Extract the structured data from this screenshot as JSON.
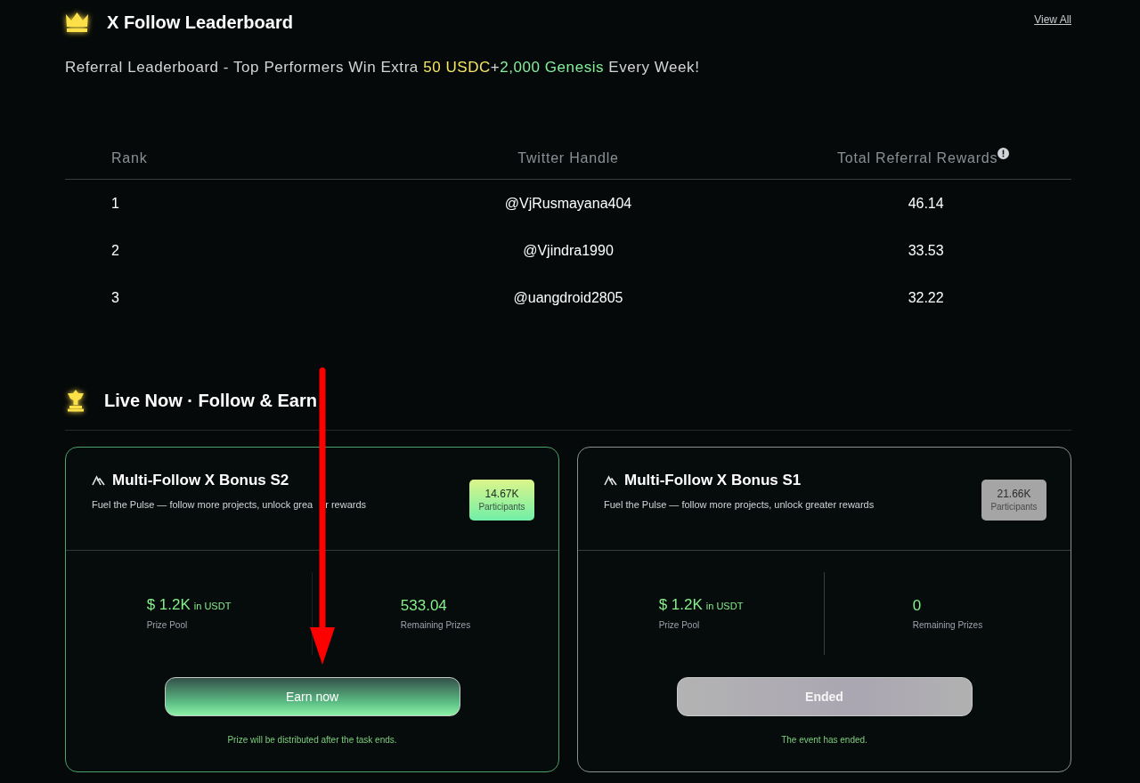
{
  "leaderboard": {
    "title": "X Follow Leaderboard",
    "view_all": "View All",
    "subtitle": [
      {
        "kind": "plain",
        "text": "Referral Leaderboard - Top Performers Win Extra "
      },
      {
        "kind": "usdc",
        "text": "50 USDC"
      },
      {
        "kind": "plain",
        "text": "+"
      },
      {
        "kind": "genesis",
        "text": "2,000 Genesis"
      },
      {
        "kind": "plain",
        "text": " Every Week!"
      }
    ],
    "table": {
      "columns": [
        "Rank",
        "Twitter Handle",
        "Total Referral Rewards"
      ],
      "rows": [
        {
          "rank": "1",
          "handle": "@VjRusmayana404",
          "rewards": "46.14"
        },
        {
          "rank": "2",
          "handle": "@Vjindra1990",
          "rewards": "33.53"
        },
        {
          "rank": "3",
          "handle": "@uangdroid2805",
          "rewards": "32.22"
        }
      ]
    }
  },
  "live_section": {
    "title": "Live Now · Follow & Earn",
    "campaigns": [
      {
        "title": "Multi-Follow X Bonus S2",
        "description": [
          "Fuel the Pulse — follow more projects, unlock grea",
          "r rewards"
        ],
        "participants": "14.67K",
        "participants_label": "Participants",
        "prize_pool": {
          "amount": "$ 1.2K",
          "unit": "in USDT",
          "label": "Prize Pool"
        },
        "remaining": {
          "value": "533.04",
          "label": "Remaining Prizes"
        },
        "button": "Earn now",
        "note": "Prize will be distributed after the task ends.",
        "ended": false
      },
      {
        "title": "Multi-Follow X Bonus S1",
        "description": [
          "Fuel the Pulse — follow more projects, unlock greater rewards"
        ],
        "participants": "21.66K",
        "participants_label": "Participants",
        "prize_pool": {
          "amount": "$ 1.2K",
          "unit": "in USDT",
          "label": "Prize Pool"
        },
        "remaining": {
          "value": "0",
          "label": "Remaining Prizes"
        },
        "button": "Ended",
        "note": "The event has ended.",
        "ended": true
      }
    ]
  },
  "annotation": {
    "kind": "arrow"
  }
}
